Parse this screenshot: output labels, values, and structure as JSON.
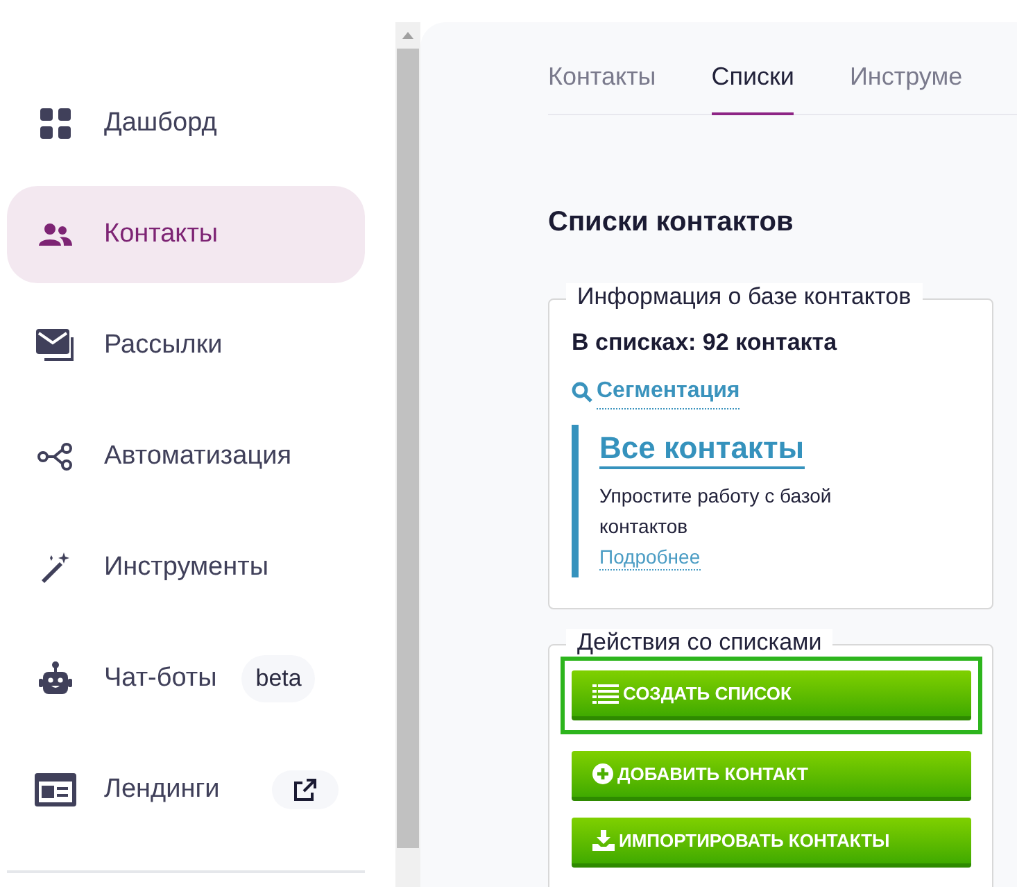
{
  "sidebar": {
    "items": [
      {
        "label": "Дашборд",
        "selected": false
      },
      {
        "label": "Контакты",
        "selected": true
      },
      {
        "label": "Рассылки",
        "selected": false
      },
      {
        "label": "Автоматизация",
        "selected": false
      },
      {
        "label": "Инструменты",
        "selected": false
      },
      {
        "label": "Чат-боты",
        "selected": false,
        "badge": "beta"
      },
      {
        "label": "Лендинги",
        "selected": false,
        "external": true
      }
    ]
  },
  "tabs": [
    {
      "label": "Контакты",
      "selected": false
    },
    {
      "label": "Списки",
      "selected": true
    },
    {
      "label": "Инструме",
      "selected": false
    }
  ],
  "heading": "Списки контактов",
  "info_panel": {
    "legend": "Информация о базе контактов",
    "count": "В списках: 92 контакта",
    "segment_link": "Сегментация",
    "callout": {
      "title": "Все контакты",
      "text": "Упростите работу с базой контактов",
      "link": "Подробнее"
    }
  },
  "actions_panel": {
    "legend": "Действия со списками",
    "buttons": [
      {
        "label": "СОЗДАТЬ СПИСОК",
        "focused": true
      },
      {
        "label": "ДОБАВИТЬ КОНТАКТ",
        "focused": false
      },
      {
        "label": "ИМПОРТИРОВАТЬ КОНТАКТЫ",
        "focused": false
      }
    ]
  }
}
